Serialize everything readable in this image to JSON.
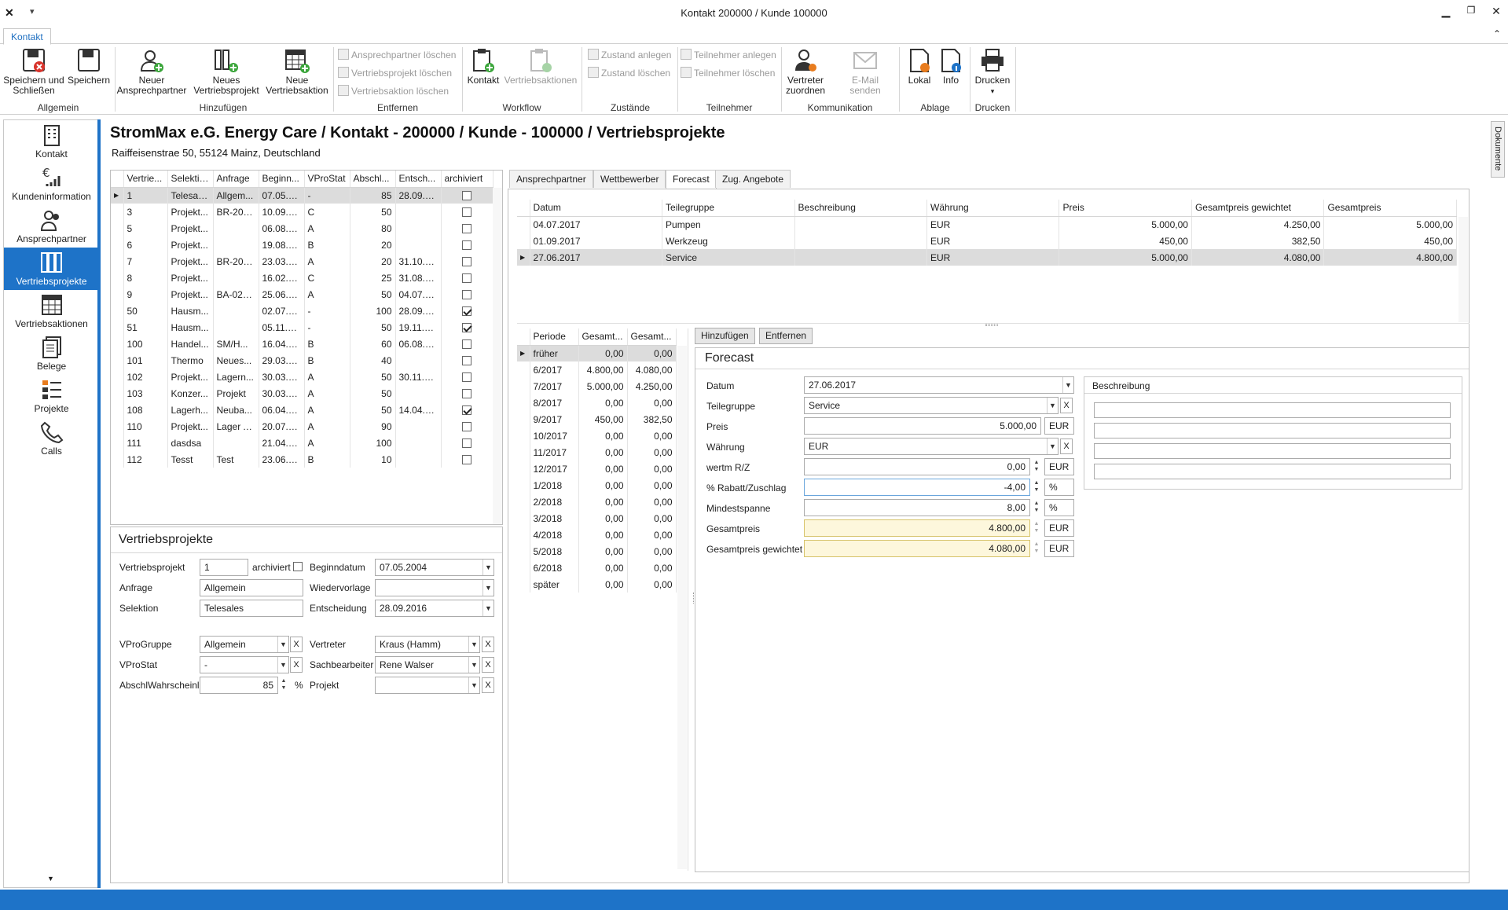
{
  "window": {
    "title": "Kontakt 200000 / Kunde 100000"
  },
  "ribbon": {
    "tab": "Kontakt",
    "save_close": "Speichern und\nSchließen",
    "save": "Speichern",
    "g_allgemein": "Allgemein",
    "new_contact": "Neuer\nAnsprechpartner",
    "new_project": "Neues\nVertriebsprojekt",
    "new_action": "Neue\nVertriebsaktion",
    "g_hinzufuegen": "Hinzufügen",
    "del_contact": "Ansprechpartner löschen",
    "del_project": "Vertriebsprojekt löschen",
    "del_action": "Vertriebsaktion löschen",
    "g_entfernen": "Entfernen",
    "kontakt": "Kontakt",
    "vertriebsaktionen": "Vertriebsaktionen",
    "g_workflow": "Workflow",
    "zustand_anlegen": "Zustand anlegen",
    "zustand_loeschen": "Zustand löschen",
    "g_zustaende": "Zustände",
    "teilnehmer_anlegen": "Teilnehmer anlegen",
    "teilnehmer_loeschen": "Teilnehmer löschen",
    "g_teilnehmer": "Teilnehmer",
    "vertreter_zuordnen": "Vertreter\nzuordnen",
    "email_senden": "E-Mail\nsenden",
    "g_kommunikation": "Kommunikation",
    "lokal": "Lokal",
    "info": "Info",
    "g_ablage": "Ablage",
    "drucken": "Drucken",
    "g_drucken": "Drucken"
  },
  "nav": {
    "items": [
      "Kontakt",
      "Kundeninformation",
      "Ansprechpartner",
      "Vertriebsprojekte",
      "Vertriebsaktionen",
      "Belege",
      "Projekte",
      "Calls"
    ],
    "selected": "Vertriebsprojekte"
  },
  "side_tab": "Dokumente",
  "header": {
    "title": "StromMax e.G. Energy Care / Kontakt - 200000 / Kunde - 100000 / Vertriebsprojekte",
    "address": "Raiffeisenstrae 50, 55124 Mainz, Deutschland"
  },
  "projects": {
    "columns": [
      "Vertrie...",
      "Selektion",
      "Anfrage",
      "Beginn...",
      "VProStat",
      "Abschl...",
      "Entsch...",
      "archiviert"
    ],
    "rows": [
      [
        "1",
        "Telesales",
        "Allgem...",
        "07.05.2...",
        "-",
        "85",
        "28.09.2...",
        false
      ],
      [
        "3",
        "Projekt...",
        "BR-200...",
        "10.09.2...",
        "C",
        "50",
        "",
        false
      ],
      [
        "5",
        "Projekt...",
        "",
        "06.08.2...",
        "A",
        "80",
        "",
        false
      ],
      [
        "6",
        "Projekt...",
        "",
        "19.08.2...",
        "B",
        "20",
        "",
        false
      ],
      [
        "7",
        "Projekt...",
        "BR-200...",
        "23.03.2...",
        "A",
        "20",
        "31.10.2...",
        false
      ],
      [
        "8",
        "Projekt...",
        "",
        "16.02.2...",
        "C",
        "25",
        "31.08.2...",
        false
      ],
      [
        "9",
        "Projekt...",
        "BA-023...",
        "25.06.2...",
        "A",
        "50",
        "04.07.2...",
        false
      ],
      [
        "50",
        "Hausm...",
        "",
        "02.07.2...",
        "-",
        "100",
        "28.09.2...",
        true
      ],
      [
        "51",
        "Hausm...",
        "",
        "05.11.2...",
        "-",
        "50",
        "19.11.2...",
        true
      ],
      [
        "100",
        "Handel...",
        "SM/H...",
        "16.04.2...",
        "B",
        "60",
        "06.08.2...",
        false
      ],
      [
        "101",
        "Thermo",
        "Neues...",
        "29.03.2...",
        "B",
        "40",
        "",
        false
      ],
      [
        "102",
        "Projekt...",
        "Lagern...",
        "30.03.2...",
        "A",
        "50",
        "30.11.2...",
        false
      ],
      [
        "103",
        "Konzer...",
        "Projekt",
        "30.03.2...",
        "A",
        "50",
        "",
        false
      ],
      [
        "108",
        "Lagerh...",
        "Neuba...",
        "06.04.2...",
        "A",
        "50",
        "14.04.2...",
        true
      ],
      [
        "110",
        "Projekt...",
        "Lager A...",
        "20.07.2...",
        "A",
        "90",
        "",
        false
      ],
      [
        "111",
        "dasdsa",
        "",
        "21.04.2...",
        "A",
        "100",
        "",
        false
      ],
      [
        "112",
        "Tesst",
        "Test",
        "23.06.2...",
        "B",
        "10",
        "",
        false
      ]
    ]
  },
  "vp_form": {
    "title": "Vertriebsprojekte",
    "l_vp": "Vertriebsprojekt",
    "v_vp": "1",
    "l_arch": "archiviert",
    "l_begin": "Beginndatum",
    "v_begin": "07.05.2004",
    "l_anfrage": "Anfrage",
    "v_anfrage": "Allgemein",
    "l_wv": "Wiedervorlage",
    "v_wv": "",
    "l_sel": "Selektion",
    "v_sel": "Telesales",
    "l_ent": "Entscheidung",
    "v_ent": "28.09.2016",
    "l_grp": "VProGruppe",
    "v_grp": "Allgemein",
    "l_vert": "Vertreter",
    "v_vert": "Kraus (Hamm)",
    "l_stat": "VProStat",
    "v_stat": "-",
    "l_sach": "Sachbearbeiter",
    "v_sach": "Rene Walser",
    "l_absch": "AbschlWahrscheinl",
    "v_absch": "85",
    "u_pct": "%",
    "l_proj": "Projekt",
    "v_proj": ""
  },
  "detail_tabs": [
    "Ansprechpartner",
    "Wettbewerber",
    "Forecast",
    "Zug. Angebote"
  ],
  "detail_tab_selected": "Forecast",
  "forecast_grid": {
    "columns": [
      "Datum",
      "Teilegruppe",
      "Beschreibung",
      "Währung",
      "Preis",
      "Gesamtpreis gewichtet",
      "Gesamtpreis"
    ],
    "rows": [
      [
        "04.07.2017",
        "Pumpen",
        "",
        "EUR",
        "5.000,00",
        "4.250,00",
        "5.000,00"
      ],
      [
        "01.09.2017",
        "Werkzeug",
        "",
        "EUR",
        "450,00",
        "382,50",
        "450,00"
      ],
      [
        "27.06.2017",
        "Service",
        "",
        "EUR",
        "5.000,00",
        "4.080,00",
        "4.800,00"
      ]
    ]
  },
  "period_grid": {
    "columns": [
      "Periode",
      "Gesamt...",
      "Gesamt..."
    ],
    "rows": [
      [
        "früher",
        "0,00",
        "0,00"
      ],
      [
        "6/2017",
        "4.800,00",
        "4.080,00"
      ],
      [
        "7/2017",
        "5.000,00",
        "4.250,00"
      ],
      [
        "8/2017",
        "0,00",
        "0,00"
      ],
      [
        "9/2017",
        "450,00",
        "382,50"
      ],
      [
        "10/2017",
        "0,00",
        "0,00"
      ],
      [
        "11/2017",
        "0,00",
        "0,00"
      ],
      [
        "12/2017",
        "0,00",
        "0,00"
      ],
      [
        "1/2018",
        "0,00",
        "0,00"
      ],
      [
        "2/2018",
        "0,00",
        "0,00"
      ],
      [
        "3/2018",
        "0,00",
        "0,00"
      ],
      [
        "4/2018",
        "0,00",
        "0,00"
      ],
      [
        "5/2018",
        "0,00",
        "0,00"
      ],
      [
        "6/2018",
        "0,00",
        "0,00"
      ],
      [
        "später",
        "0,00",
        "0,00"
      ]
    ]
  },
  "fc_buttons": {
    "add": "Hinzufügen",
    "remove": "Entfernen"
  },
  "fc_form": {
    "title": "Forecast",
    "l_datum": "Datum",
    "v_datum": "27.06.2017",
    "l_tg": "Teilegruppe",
    "v_tg": "Service",
    "l_preis": "Preis",
    "v_preis": "5.000,00",
    "u_eur": "EUR",
    "l_wae": "Währung",
    "v_wae": "EUR",
    "l_wrz": "wertm R/Z",
    "v_wrz": "0,00",
    "l_rab": "% Rabatt/Zuschlag",
    "v_rab": "-4,00",
    "u_pct": "%",
    "l_min": "Mindestspanne",
    "v_min": "8,00",
    "l_gp": "Gesamtpreis",
    "v_gp": "4.800,00",
    "l_gpg": "Gesamtpreis gewichtet",
    "v_gpg": "4.080,00",
    "l_besch": "Beschreibung",
    "x": "X"
  }
}
